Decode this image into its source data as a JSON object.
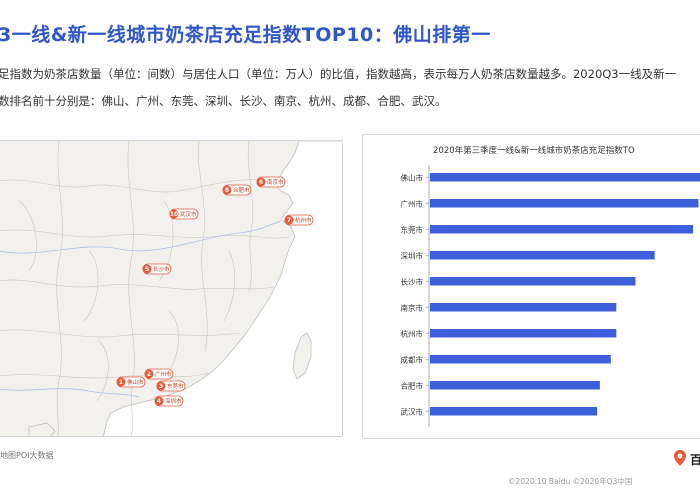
{
  "header": {
    "title": "3一线&新一线城市奶茶店充足指数TOP10：佛山排第一",
    "desc_line1": "足指数为奶茶店数量（单位：间数）与居住人口（单位：万人）的比值，指数越高，表示每万人奶茶店数量越多。2020Q3一线及新一",
    "desc_line2": "数排名前十分别是：佛山、广州、东莞、深圳、长沙、南京、杭州、成都、合肥、武汉。"
  },
  "map": {
    "markers": [
      {
        "rank": "1",
        "city": "佛山市"
      },
      {
        "rank": "2",
        "city": "广州市"
      },
      {
        "rank": "3",
        "city": "东莞市"
      },
      {
        "rank": "4",
        "city": "深圳市"
      },
      {
        "rank": "5",
        "city": "长沙市"
      },
      {
        "rank": "6",
        "city": "南京市"
      },
      {
        "rank": "7",
        "city": "杭州市"
      },
      {
        "rank": "8",
        "city": "合肥市"
      },
      {
        "rank": "10",
        "city": "武汉市"
      }
    ],
    "accent_color": "#e8593a",
    "land_color": "#f3f1ee",
    "sea_color": "#ffffff"
  },
  "chart_data": {
    "type": "bar",
    "orientation": "horizontal",
    "title": "2020年第三季度一线&新一线城市奶茶店充足指数TO",
    "categories": [
      "佛山市",
      "广州市",
      "东莞市",
      "深圳市",
      "长沙市",
      "南京市",
      "杭州市",
      "成都市",
      "合肥市",
      "武汉市"
    ],
    "values": [
      100,
      98,
      96,
      82,
      75,
      68,
      68,
      66,
      62,
      61
    ],
    "xlim": [
      0,
      100
    ],
    "bar_color": "#3d5fd9",
    "grid": false,
    "legend": "none"
  },
  "footer": {
    "source": "地图POI大数据",
    "copyright": "©2020.10 Baidu  ©2020年Q3中国",
    "logo_text": "百"
  }
}
